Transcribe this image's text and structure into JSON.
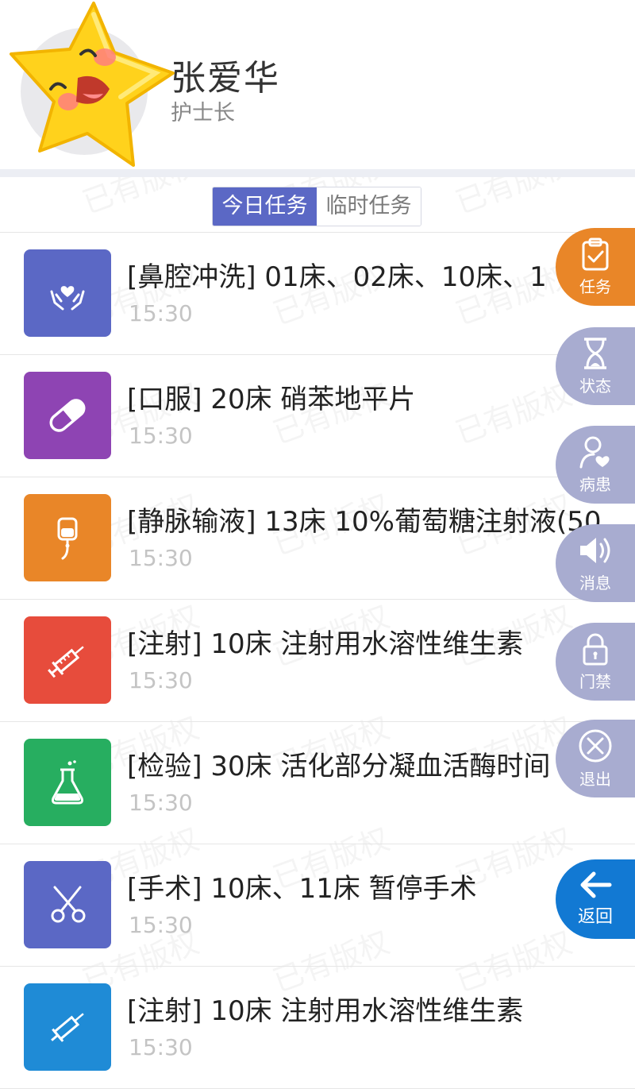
{
  "header": {
    "name": "张爱华",
    "role": "护士长"
  },
  "tabs": [
    {
      "label": "今日任务",
      "active": true
    },
    {
      "label": "临时任务",
      "active": false
    }
  ],
  "watermark_text": "已有版权",
  "tasks": [
    {
      "title": "[鼻腔冲洗] 01床、02床、10床、1",
      "time": "15:30",
      "color": "#5b68c5",
      "icon": "hands-heart-icon"
    },
    {
      "title": "[口服] 20床 硝苯地平片",
      "time": "15:30",
      "color": "#8e44b3",
      "icon": "pill-icon"
    },
    {
      "title": "[静脉输液] 13床 10%葡萄糖注射液(50",
      "time": "15:30",
      "color": "#e98628",
      "icon": "iv-drip-icon"
    },
    {
      "title": "[注射] 10床 注射用水溶性维生素",
      "time": "15:30",
      "color": "#e74c3c",
      "icon": "syringe-icon"
    },
    {
      "title": "[检验] 30床 活化部分凝血活酶时间",
      "time": "15:30",
      "color": "#27ae60",
      "icon": "flask-icon"
    },
    {
      "title": "[手术] 10床、11床  暂停手术",
      "time": "15:30",
      "color": "#5b68c5",
      "icon": "scissors-icon"
    },
    {
      "title": "[注射] 10床 注射用水溶性维生素",
      "time": "15:30",
      "color": "#1f8bd6",
      "icon": "syringe-icon"
    }
  ],
  "side_buttons": [
    {
      "label": "任务",
      "icon": "clipboard-check-icon",
      "color": "#e98628"
    },
    {
      "label": "状态",
      "icon": "hourglass-icon",
      "color": "#a8acd0"
    },
    {
      "label": "病患",
      "icon": "patient-heart-icon",
      "color": "#a8acd0"
    },
    {
      "label": "消息",
      "icon": "speaker-icon",
      "color": "#a8acd0"
    },
    {
      "label": "门禁",
      "icon": "lock-icon",
      "color": "#a8acd0"
    },
    {
      "label": "退出",
      "icon": "close-circle-icon",
      "color": "#a8acd0"
    },
    {
      "label": "返回",
      "icon": "arrow-left-icon",
      "color": "#1279d3"
    }
  ]
}
